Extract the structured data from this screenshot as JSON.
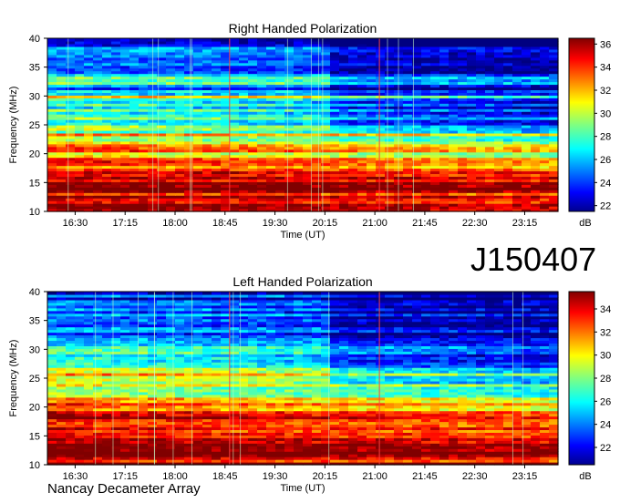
{
  "figure_id": "J150407",
  "footer": "Nancay Decameter Array",
  "chart_data": [
    {
      "type": "heatmap",
      "title": "Right Handed Polarization",
      "xlabel": "Time (UT)",
      "ylabel": "Frequency (MHz)",
      "x_ticks": [
        "16:30",
        "17:15",
        "18:00",
        "18:45",
        "19:30",
        "20:15",
        "21:00",
        "21:45",
        "22:30",
        "23:15"
      ],
      "y_ticks": [
        10,
        15,
        20,
        25,
        30,
        35,
        40
      ],
      "ylim": [
        10,
        40
      ],
      "colorbar": {
        "label": "dB",
        "ticks": [
          22,
          24,
          26,
          28,
          30,
          32,
          34,
          36
        ],
        "range": [
          21.5,
          36.5
        ]
      },
      "intensity_profile_by_freq": [
        [
          10,
          34
        ],
        [
          12,
          35
        ],
        [
          15,
          34
        ],
        [
          18,
          33
        ],
        [
          20,
          30
        ],
        [
          22,
          29
        ],
        [
          25,
          27
        ],
        [
          28,
          26
        ],
        [
          30,
          25
        ],
        [
          33,
          24
        ],
        [
          36,
          24
        ],
        [
          40,
          23
        ]
      ],
      "background_db": 24,
      "band_edge_markers_utc": [
        "18:45",
        "21:00"
      ]
    },
    {
      "type": "heatmap",
      "title": "Left Handed Polarization",
      "xlabel": "Time (UT)",
      "ylabel": "Frequency (MHz)",
      "x_ticks": [
        "16:30",
        "17:15",
        "18:00",
        "18:45",
        "19:30",
        "20:15",
        "21:00",
        "21:45",
        "22:30",
        "23:15"
      ],
      "y_ticks": [
        10,
        15,
        20,
        25,
        30,
        35,
        40
      ],
      "ylim": [
        10,
        40
      ],
      "colorbar": {
        "label": "dB",
        "ticks": [
          22,
          24,
          26,
          28,
          30,
          32,
          34
        ],
        "range": [
          20.5,
          35.5
        ]
      },
      "intensity_profile_by_freq": [
        [
          10,
          33
        ],
        [
          12,
          34
        ],
        [
          15,
          33
        ],
        [
          18,
          32
        ],
        [
          20,
          30
        ],
        [
          22,
          28
        ],
        [
          25,
          27
        ],
        [
          28,
          25
        ],
        [
          30,
          24
        ],
        [
          33,
          23
        ],
        [
          36,
          23
        ],
        [
          40,
          22
        ]
      ],
      "background_db": 23,
      "band_edge_markers_utc": [
        "18:45",
        "21:00"
      ]
    }
  ]
}
